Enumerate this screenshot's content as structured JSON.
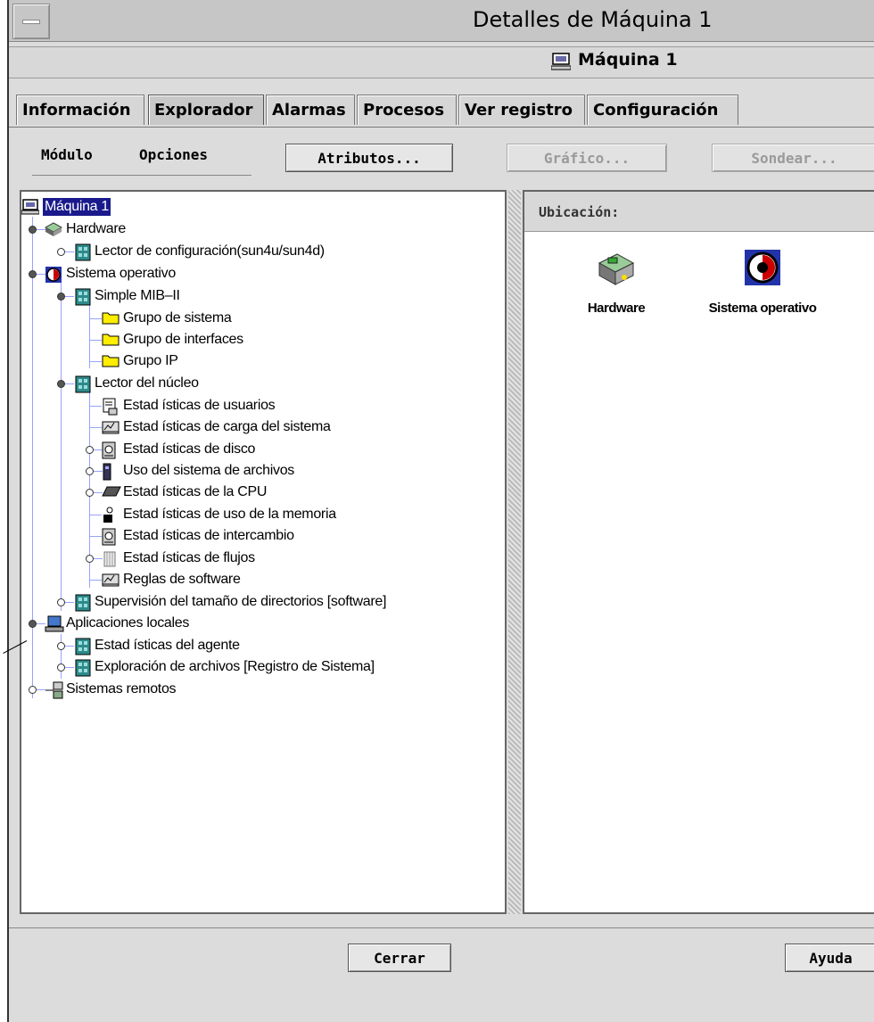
{
  "window": {
    "title": "Detalles de Máquina 1"
  },
  "header": {
    "title": "Máquina 1",
    "icon": "computer-icon"
  },
  "tabs": [
    {
      "label": "Información",
      "active": false
    },
    {
      "label": "Explorador",
      "active": true
    },
    {
      "label": "Alarmas",
      "active": false
    },
    {
      "label": "Procesos",
      "active": false
    },
    {
      "label": "Ver registro",
      "active": false
    },
    {
      "label": "Configuración",
      "active": false
    }
  ],
  "toolbar": {
    "module_menu": "Módulo",
    "options_menu": "Opciones",
    "attributes_button": "Atributos...",
    "graph_button": "Gráfico...",
    "probe_button": "Sondear..."
  },
  "tree": [
    {
      "label": "Máquina 1",
      "icon": "computer-icon",
      "selected": true
    },
    {
      "label": "Hardware",
      "icon": "hardware-icon"
    },
    {
      "label": "Lector de configuración(sun4u/sun4d)",
      "icon": "module-icon"
    },
    {
      "label": "Sistema operativo",
      "icon": "operating-system-icon"
    },
    {
      "label": "Simple MIB–II",
      "icon": "module-icon"
    },
    {
      "label": "Grupo de sistema",
      "icon": "folder-icon"
    },
    {
      "label": "Grupo de interfaces",
      "icon": "folder-icon"
    },
    {
      "label": "Grupo IP",
      "icon": "folder-icon"
    },
    {
      "label": "Lector del núcleo",
      "icon": "module-icon"
    },
    {
      "label": "Estad ísticas de usuarios",
      "icon": "users-stats-icon"
    },
    {
      "label": "Estad ísticas de carga del sistema",
      "icon": "load-stats-icon"
    },
    {
      "label": "Estad ísticas de disco",
      "icon": "disk-icon"
    },
    {
      "label": "Uso del sistema de archivos",
      "icon": "filesystem-icon"
    },
    {
      "label": "Estad ísticas de la CPU",
      "icon": "cpu-icon"
    },
    {
      "label": "Estad ísticas de uso de la memoria",
      "icon": "memory-icon"
    },
    {
      "label": "Estad ísticas de intercambio",
      "icon": "swap-icon"
    },
    {
      "label": "Estad ísticas de flujos",
      "icon": "streams-icon"
    },
    {
      "label": "Reglas de software",
      "icon": "software-rules-icon"
    },
    {
      "label": "Supervisión del tamaño de directorios [software]",
      "icon": "module-icon"
    },
    {
      "label": "Aplicaciones locales",
      "icon": "local-apps-icon"
    },
    {
      "label": "Estad ísticas del agente",
      "icon": "module-icon"
    },
    {
      "label": "Exploración de archivos [Registro de Sistema]",
      "icon": "module-icon"
    },
    {
      "label": "Sistemas remotos",
      "icon": "remote-systems-icon"
    }
  ],
  "content": {
    "location_label": "Ubicación:",
    "items": [
      {
        "label": "Hardware",
        "icon": "hardware-icon"
      },
      {
        "label": "Sistema operativo",
        "icon": "operating-system-icon"
      }
    ]
  },
  "footer": {
    "close_button": "Cerrar",
    "help_button": "Ayuda"
  }
}
